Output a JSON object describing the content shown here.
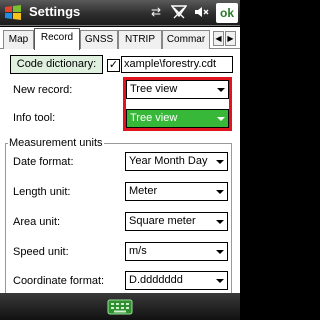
{
  "window": {
    "title": "Settings",
    "ok_label": "ok"
  },
  "tray": {
    "connectivity_icon": "connectivity-icon",
    "signal_icon": "signal-off-icon",
    "volume_icon": "volume-off-icon"
  },
  "tabs": [
    {
      "label": "Map",
      "active": false
    },
    {
      "label": "Record",
      "active": true
    },
    {
      "label": "GNSS",
      "active": false
    },
    {
      "label": "NTRIP",
      "active": false
    },
    {
      "label": "Commar",
      "active": false
    }
  ],
  "record": {
    "code_dictionary_button": "Code dictionary:",
    "code_dictionary_enabled": true,
    "code_dictionary_path": "xample\\forestry.cdt",
    "new_record_label": "New record:",
    "new_record_value": "Tree view",
    "info_tool_label": "Info tool:",
    "info_tool_value": "Tree view"
  },
  "units": {
    "group_title": "Measurement units",
    "date_format_label": "Date format:",
    "date_format_value": "Year Month Day",
    "length_unit_label": "Length unit:",
    "length_unit_value": "Meter",
    "area_unit_label": "Area unit:",
    "area_unit_value": "Square meter",
    "speed_unit_label": "Speed unit:",
    "speed_unit_value": "m/s",
    "coordinate_format_label": "Coordinate format:",
    "coordinate_format_value": "D.ddddddd"
  },
  "colors": {
    "accent_green": "#38b838",
    "highlight_red": "#e0141e",
    "button_bg": "#dff0df"
  }
}
